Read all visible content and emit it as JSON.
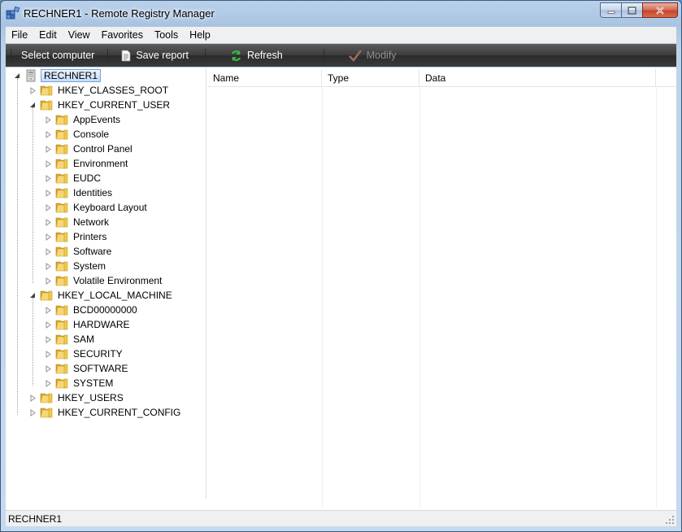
{
  "window": {
    "title": "RECHNER1 - Remote Registry Manager"
  },
  "menu": [
    "File",
    "Edit",
    "View",
    "Favorites",
    "Tools",
    "Help"
  ],
  "toolbar": {
    "select_computer": "Select computer",
    "save_report": "Save report",
    "refresh": "Refresh",
    "modify": "Modify"
  },
  "tree": {
    "root": "RECHNER1",
    "hives": {
      "classes_root": "HKEY_CLASSES_ROOT",
      "current_user": "HKEY_CURRENT_USER",
      "local_machine": "HKEY_LOCAL_MACHINE",
      "users": "HKEY_USERS",
      "current_config": "HKEY_CURRENT_CONFIG"
    },
    "current_user_children": [
      "AppEvents",
      "Console",
      "Control Panel",
      "Environment",
      "EUDC",
      "Identities",
      "Keyboard Layout",
      "Network",
      "Printers",
      "Software",
      "System",
      "Volatile Environment"
    ],
    "local_machine_children": [
      "BCD00000000",
      "HARDWARE",
      "SAM",
      "SECURITY",
      "SOFTWARE",
      "SYSTEM"
    ]
  },
  "list": {
    "columns": [
      "Name",
      "Type",
      "Data"
    ]
  },
  "status": {
    "text": "RECHNER1"
  }
}
